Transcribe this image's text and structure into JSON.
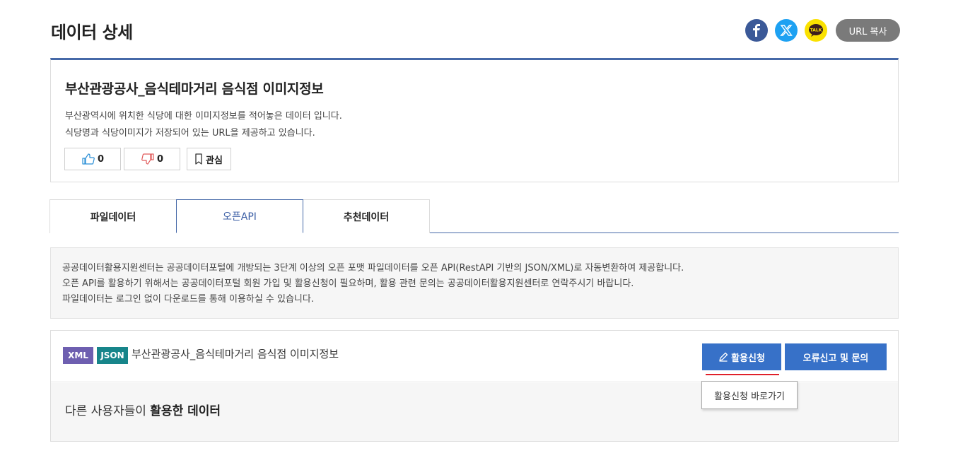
{
  "page": {
    "title": "데이터 상세"
  },
  "share": {
    "facebook_icon": "facebook-icon",
    "x_icon": "x-twitter-icon",
    "kakao_icon": "kakaotalk-icon",
    "kakao_label": "TALK",
    "url_copy_label": "URL 복사"
  },
  "detail": {
    "title": "부산관광공사_음식테마거리 음식점 이미지정보",
    "description_line1": "부산광역시에 위치한 식당에 대한 이미지정보를 적어놓은 데이터 입니다.",
    "description_line2": "식당명과 식당이미지가 저장되어 있는 URL을 제공하고 있습니다.",
    "like_count": "0",
    "dislike_count": "0",
    "favorite_label": "관심"
  },
  "tabs": [
    {
      "label": "파일데이터",
      "active": false
    },
    {
      "label": "오픈API",
      "active": true
    },
    {
      "label": "추천데이터",
      "active": false
    }
  ],
  "info": {
    "line1": "공공데이터활용지원센터는 공공데이터포털에 개방되는 3단계 이상의 오픈 포맷 파일데이터를 오픈 API(RestAPI 기반의 JSON/XML)로 자동변환하여 제공합니다.",
    "line2": "오픈 API를 활용하기 위해서는 공공데이터포털 회원 가입 및 활용신청이 필요하며, 활용 관련 문의는 공공데이터활용지원센터로 연락주시기 바랍니다.",
    "line3": "파일데이터는 로그인 없이 다운로드를 통해 이용하실 수 있습니다."
  },
  "api": {
    "tag_xml": "XML",
    "tag_json": "JSON",
    "name": "부산관광공사_음식테마거리 음식점 이미지정보",
    "apply_label": "활용신청",
    "report_label": "오류신고 및 문의",
    "tooltip": "활용신청 바로가기"
  },
  "used": {
    "prefix": "다른 사용자들이",
    "bold": "활용한 데이터"
  },
  "colors": {
    "accent_blue": "#3771c8",
    "tab_border": "#4669a8",
    "xml_tag": "#6e5fb0",
    "json_tag": "#17858a",
    "highlight_red": "#e0202a"
  }
}
